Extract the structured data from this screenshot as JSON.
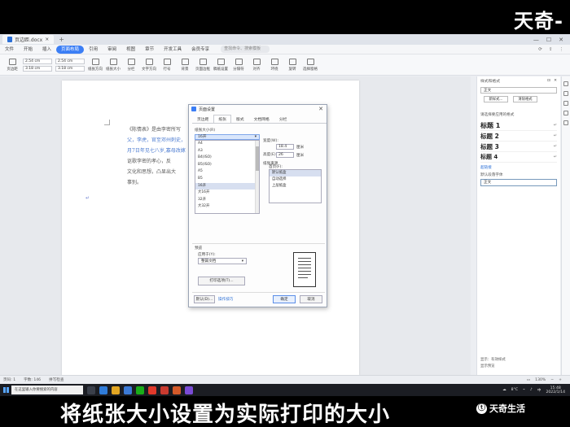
{
  "top_brand": "天奇-",
  "window": {
    "tab_title": "页边距.docx",
    "menu": [
      "文件",
      "开始",
      "插入",
      "页面布局",
      "引用",
      "审阅",
      "视图",
      "章节",
      "开发工具",
      "会员专享"
    ],
    "menu_active_index": 3,
    "search_placeholder": "查找命令、搜索模板"
  },
  "ribbon": {
    "margins_label": "页边距",
    "field_top": "2.54 cm",
    "field_bottom": "2.54 cm",
    "field_left": "3.18 cm",
    "field_right": "3.18 cm",
    "buttons": [
      "纸张方向",
      "纸张大小",
      "分栏",
      "文字方向",
      "行号",
      "背景",
      "页面边框",
      "稿纸设置",
      "分隔符",
      "对齐",
      "环绕",
      "旋转",
      "选择窗格"
    ]
  },
  "document": {
    "lines": [
      "《陈情表》是由李密所写",
      "父，李虎，官至邓州刺史，",
      "月7日年见七八岁,寡母改嫁",
      "讴歌李密的孝心，反",
      "文化和思想，凸显出大",
      "事别。"
    ]
  },
  "dialog": {
    "title": "页面设置",
    "tabs": [
      "页边距",
      "纸张",
      "版式",
      "文档网格",
      "分栏"
    ],
    "active_tab_index": 1,
    "paper_size_label": "纸张大小(R)",
    "paper_size_value": "16开",
    "paper_options": [
      "A4",
      "A3",
      "B4(ISO)",
      "B5(ISO)",
      "A5",
      "B5",
      "16开",
      "大16开",
      "32开",
      "大32开"
    ],
    "width_label": "宽度(W):",
    "width_value": "18.4",
    "width_unit": "厘米",
    "height_label": "高度(E):",
    "height_value": "26",
    "height_unit": "厘米",
    "source_label": "纸张来源",
    "source_first_label": "首页(F):",
    "source_options": [
      "默认纸盒",
      "自动选择",
      "上层纸盒"
    ],
    "preview_label": "预览",
    "apply_label": "应用于(Y):",
    "apply_value": "整篇文档",
    "print_options_btn": "打印选项(T)...",
    "default_btn": "默认(D)...",
    "tips_btn": "操作技巧",
    "ok_btn": "确定",
    "cancel_btn": "取消"
  },
  "right_pane": {
    "title": "样式和格式",
    "current_style": "正文",
    "new_style_btn": "新样式...",
    "clear_format_btn": "清除格式",
    "subhead": "请选择要应用的格式",
    "styles": [
      "标题 1",
      "标题 2",
      "标题 3",
      "标题 4"
    ],
    "link_item": "超链接",
    "plain_item": "默认段落字体",
    "body_item": "正文",
    "bottom_show": "显示：有效样式",
    "bottom_preview": "显示预览"
  },
  "statusbar": {
    "page": "页码: 1",
    "words": "字数: 146",
    "spell": "拼写检查",
    "zoom": "130%"
  },
  "taskbar": {
    "search_text": "在这里输入你要搜索的内容",
    "temp": "8°C",
    "time": "15:48",
    "date": "2022/1/14"
  },
  "subtitle": {
    "text": "将纸张大小设置为实际打印的大小",
    "brand": "天奇生活"
  },
  "colors": {
    "accent": "#3b7ef5",
    "link": "#2b6fd6"
  }
}
